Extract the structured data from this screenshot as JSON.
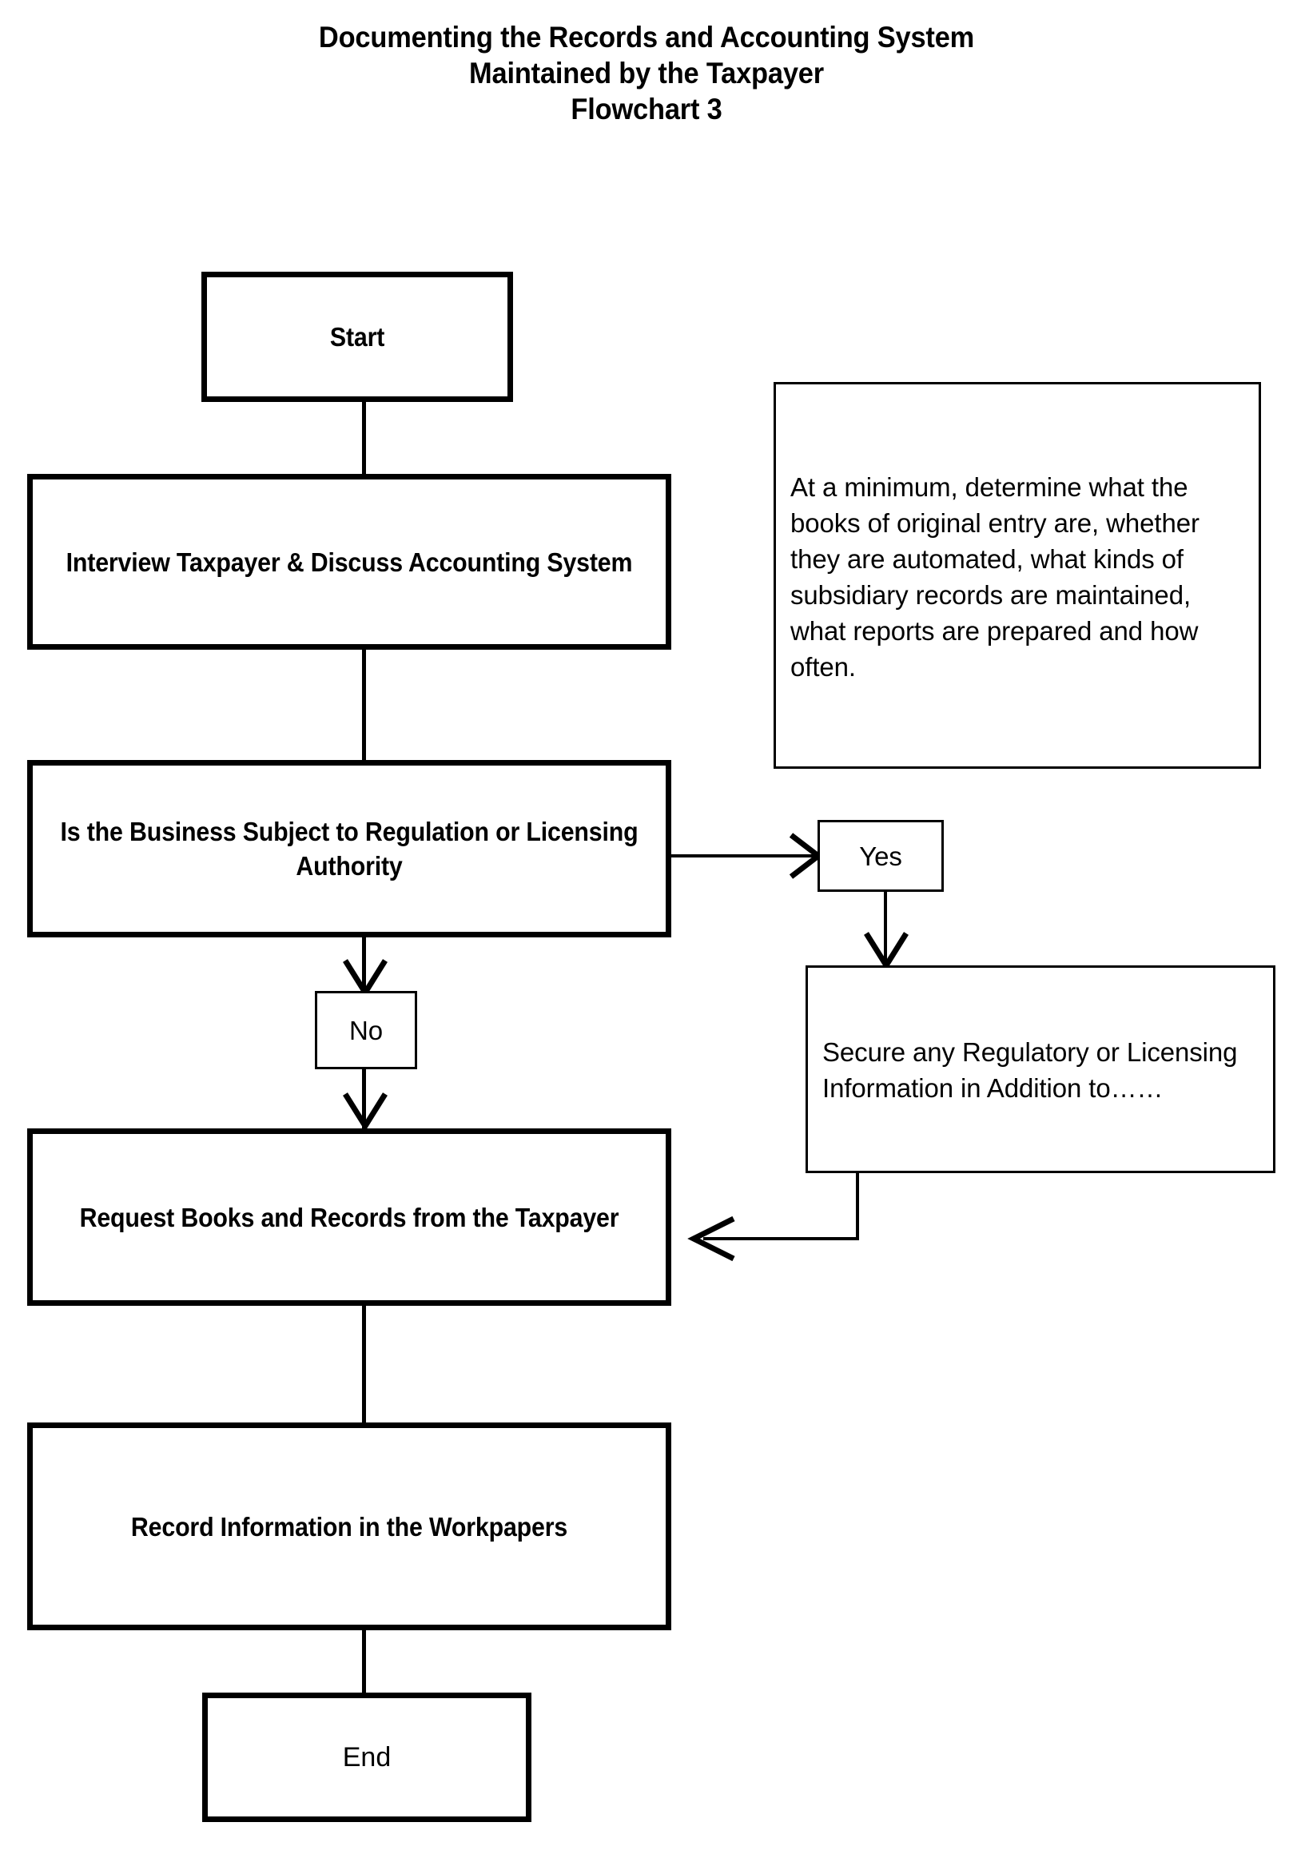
{
  "title": {
    "line1": "Documenting the Records and Accounting System",
    "line2": "Maintained by the Taxpayer",
    "line3": "Flowchart 3"
  },
  "nodes": {
    "start": {
      "label": "Start"
    },
    "interview": {
      "label": "Interview Taxpayer & Discuss Accounting System"
    },
    "decision": {
      "label": "Is the Business Subject to Regulation or Licensing Authority"
    },
    "yes_label": {
      "label": "Yes"
    },
    "no_label": {
      "label": "No"
    },
    "note": {
      "label": "At a minimum, determine what the books of original entry are, whether they are automated, what kinds of subsidiary records are maintained, what reports are prepared and how often."
    },
    "secure": {
      "label": "Secure any Regulatory or Licensing Information in Addition to……"
    },
    "request": {
      "label": "Request Books and Records from the Taxpayer"
    },
    "record": {
      "label": "Record Information in the Workpapers"
    },
    "end": {
      "label": "End"
    }
  },
  "colors": {
    "stroke": "#000000",
    "background": "#ffffff",
    "text": "#000000"
  },
  "chart_data": {
    "type": "diagram",
    "diagram_kind": "flowchart",
    "title": "Documenting the Records and Accounting System Maintained by the Taxpayer — Flowchart 3",
    "nodes": [
      {
        "id": "start",
        "text": "Start",
        "shape": "rectangle",
        "style": "thick-border"
      },
      {
        "id": "interview",
        "text": "Interview Taxpayer & Discuss Accounting System",
        "shape": "rectangle",
        "style": "thick-border"
      },
      {
        "id": "decision",
        "text": "Is the Business Subject to Regulation or Licensing Authority",
        "shape": "rectangle",
        "style": "thick-border"
      },
      {
        "id": "yes_label",
        "text": "Yes",
        "shape": "rectangle",
        "style": "thin-border"
      },
      {
        "id": "no_label",
        "text": "No",
        "shape": "rectangle",
        "style": "thin-border"
      },
      {
        "id": "note",
        "text": "At a minimum, determine what the books of original entry are, whether they are automated, what kinds of subsidiary records are maintained, what reports are prepared and how often.",
        "shape": "rectangle",
        "style": "thin-border-annotation"
      },
      {
        "id": "secure",
        "text": "Secure any Regulatory or Licensing Information in Addition to……",
        "shape": "rectangle",
        "style": "thin-border"
      },
      {
        "id": "request",
        "text": "Request Books and Records from the Taxpayer",
        "shape": "rectangle",
        "style": "thick-border"
      },
      {
        "id": "record",
        "text": "Record Information in the Workpapers",
        "shape": "rectangle",
        "style": "thick-border"
      },
      {
        "id": "end",
        "text": "End",
        "shape": "rectangle",
        "style": "thick-border"
      }
    ],
    "edges": [
      {
        "from": "start",
        "to": "interview",
        "label": "",
        "arrow": false
      },
      {
        "from": "interview",
        "to": "decision",
        "label": "",
        "arrow": false
      },
      {
        "from": "decision",
        "to": "yes_label",
        "label": "Yes",
        "arrow": true,
        "direction": "right"
      },
      {
        "from": "yes_label",
        "to": "secure",
        "label": "",
        "arrow": true,
        "direction": "down"
      },
      {
        "from": "decision",
        "to": "no_label",
        "label": "No",
        "arrow": true,
        "direction": "down"
      },
      {
        "from": "no_label",
        "to": "request",
        "label": "",
        "arrow": true,
        "direction": "down"
      },
      {
        "from": "secure",
        "to": "request",
        "label": "",
        "arrow": true,
        "direction": "left"
      },
      {
        "from": "request",
        "to": "record",
        "label": "",
        "arrow": false
      },
      {
        "from": "record",
        "to": "end",
        "label": "",
        "arrow": false
      }
    ]
  }
}
